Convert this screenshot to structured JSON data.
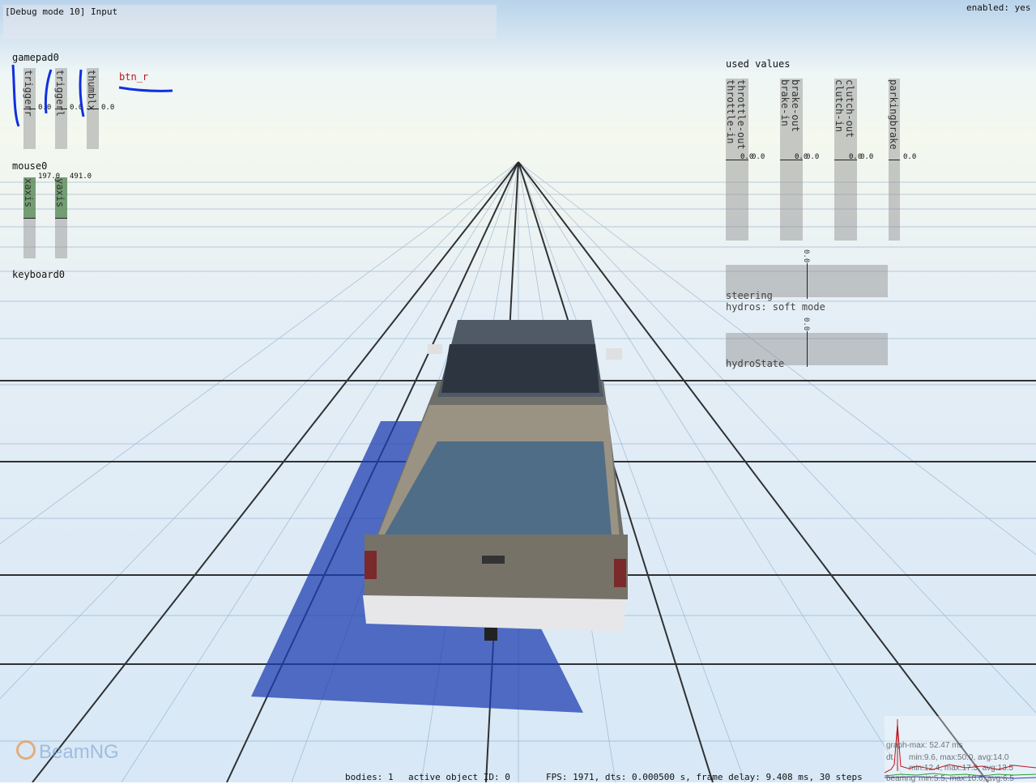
{
  "debug": {
    "title": "[Debug mode 10] Input",
    "enabled": "enabled: yes"
  },
  "gamepad": {
    "name": "gamepad0",
    "axes": [
      {
        "label": "triggerr",
        "value": "0.0"
      },
      {
        "label": "triggerl",
        "value": "0.0"
      },
      {
        "label": "thumblx",
        "value": "0.0"
      }
    ],
    "button": "btn_r"
  },
  "mouse": {
    "name": "mouse0",
    "axes": [
      {
        "label": "xaxis",
        "value": "197.0"
      },
      {
        "label": "yaxis",
        "value": "491.0"
      }
    ]
  },
  "keyboard": {
    "name": "keyboard0"
  },
  "used": {
    "title": "used values",
    "channels": [
      {
        "out": "throttle-out",
        "in": "throttle-in",
        "value": "0.0",
        "value2": "0.0"
      },
      {
        "out": "brake-out",
        "in": "brake-in",
        "value": "0.0",
        "value2": "0.0"
      },
      {
        "out": "clutch-out",
        "in": "clutch-in",
        "value": "0.0",
        "value2": "0.0"
      },
      {
        "out": "parkingbrake",
        "in": "",
        "value": "0.0",
        "value2": ""
      }
    ],
    "steering": {
      "label": "steering",
      "value": "0.0",
      "mode": "hydros: soft mode"
    },
    "hydro": {
      "label": "hydroState",
      "value": "0.0"
    }
  },
  "status": {
    "bodies": "bodies: 1",
    "active": "active object ID: 0",
    "fps": "FPS: 1971, dts: 0.000500 s, frame delay: 9.408 ms, 30 steps"
  },
  "graph": {
    "max": "graph-max: 52.47 ms",
    "dt": "dt",
    "dt_stats": "min:9.6, max:50.0, avg:14.0",
    "line3": "min:12.4, max:17.3, avg:13.5",
    "beamng": "beamng",
    "line4": "min:5.5, max:10.6, avg:6.5"
  },
  "logo": "BeamNG",
  "colors": {
    "accent_red": "#c0141c",
    "annotation_blue": "#1030e0",
    "bar_gray": "#8c8c8c",
    "mouse_green": "#5a8f5a"
  }
}
